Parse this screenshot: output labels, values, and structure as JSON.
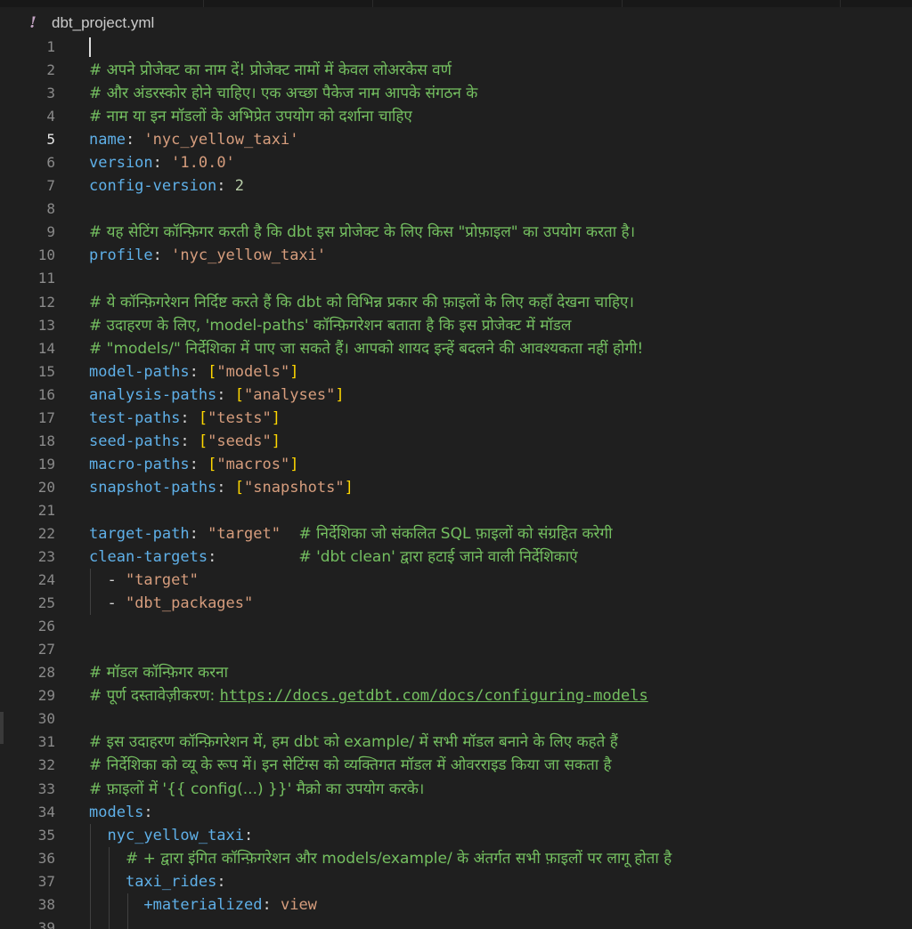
{
  "tab": {
    "icon": "yaml-exclamation-icon",
    "icon_glyph": "!",
    "filename": "dbt_project.yml"
  },
  "editor": {
    "active_line": 5,
    "lines": [
      {
        "n": "1",
        "tokens": []
      },
      {
        "n": "2",
        "tokens": [
          {
            "t": "# अपने प्रोजेक्ट का नाम दें! प्रोजेक्ट नामों में केवल लोअरकेस वर्ण",
            "c": "c"
          }
        ]
      },
      {
        "n": "3",
        "tokens": [
          {
            "t": "# और अंडरस्कोर होने चाहिए। एक अच्छा पैकेज नाम आपके संगठन के",
            "c": "c"
          }
        ]
      },
      {
        "n": "4",
        "tokens": [
          {
            "t": "# नाम या इन मॉडलों के अभिप्रेत उपयोग को दर्शाना चाहिए",
            "c": "c"
          }
        ]
      },
      {
        "n": "5",
        "tokens": [
          {
            "t": "name",
            "c": "k"
          },
          {
            "t": ": ",
            "c": "p"
          },
          {
            "t": "'nyc_yellow_taxi'",
            "c": "s"
          }
        ]
      },
      {
        "n": "6",
        "tokens": [
          {
            "t": "version",
            "c": "k"
          },
          {
            "t": ": ",
            "c": "p"
          },
          {
            "t": "'1.0.0'",
            "c": "s"
          }
        ]
      },
      {
        "n": "7",
        "tokens": [
          {
            "t": "config-version",
            "c": "k"
          },
          {
            "t": ": ",
            "c": "p"
          },
          {
            "t": "2",
            "c": "n"
          }
        ]
      },
      {
        "n": "8",
        "tokens": []
      },
      {
        "n": "9",
        "tokens": [
          {
            "t": "# यह सेटिंग कॉन्फ़िगर करती है कि dbt इस प्रोजेक्ट के लिए किस \"प्रोफ़ाइल\" का उपयोग करता है।",
            "c": "c"
          }
        ]
      },
      {
        "n": "10",
        "tokens": [
          {
            "t": "profile",
            "c": "k"
          },
          {
            "t": ": ",
            "c": "p"
          },
          {
            "t": "'nyc_yellow_taxi'",
            "c": "s"
          }
        ]
      },
      {
        "n": "11",
        "tokens": []
      },
      {
        "n": "12",
        "tokens": [
          {
            "t": "# ये कॉन्फ़िगरेशन निर्दिष्ट करते हैं कि dbt को विभिन्न प्रकार की फ़ाइलों के लिए कहाँ देखना चाहिए।",
            "c": "c"
          }
        ]
      },
      {
        "n": "13",
        "tokens": [
          {
            "t": "# उदाहरण के लिए, 'model-paths' कॉन्फ़िगरेशन बताता है कि इस प्रोजेक्ट में मॉडल",
            "c": "c"
          }
        ]
      },
      {
        "n": "14",
        "tokens": [
          {
            "t": "# \"models/\" निर्देशिका में पाए जा सकते हैं। आपको शायद इन्हें बदलने की आवश्यकता नहीं होगी!",
            "c": "c"
          }
        ]
      },
      {
        "n": "15",
        "tokens": [
          {
            "t": "model-paths",
            "c": "k"
          },
          {
            "t": ": ",
            "c": "p"
          },
          {
            "t": "[",
            "c": "b"
          },
          {
            "t": "\"models\"",
            "c": "s"
          },
          {
            "t": "]",
            "c": "b"
          }
        ]
      },
      {
        "n": "16",
        "tokens": [
          {
            "t": "analysis-paths",
            "c": "k"
          },
          {
            "t": ": ",
            "c": "p"
          },
          {
            "t": "[",
            "c": "b"
          },
          {
            "t": "\"analyses\"",
            "c": "s"
          },
          {
            "t": "]",
            "c": "b"
          }
        ]
      },
      {
        "n": "17",
        "tokens": [
          {
            "t": "test-paths",
            "c": "k"
          },
          {
            "t": ": ",
            "c": "p"
          },
          {
            "t": "[",
            "c": "b"
          },
          {
            "t": "\"tests\"",
            "c": "s"
          },
          {
            "t": "]",
            "c": "b"
          }
        ]
      },
      {
        "n": "18",
        "tokens": [
          {
            "t": "seed-paths",
            "c": "k"
          },
          {
            "t": ": ",
            "c": "p"
          },
          {
            "t": "[",
            "c": "b"
          },
          {
            "t": "\"seeds\"",
            "c": "s"
          },
          {
            "t": "]",
            "c": "b"
          }
        ]
      },
      {
        "n": "19",
        "tokens": [
          {
            "t": "macro-paths",
            "c": "k"
          },
          {
            "t": ": ",
            "c": "p"
          },
          {
            "t": "[",
            "c": "b"
          },
          {
            "t": "\"macros\"",
            "c": "s"
          },
          {
            "t": "]",
            "c": "b"
          }
        ]
      },
      {
        "n": "20",
        "tokens": [
          {
            "t": "snapshot-paths",
            "c": "k"
          },
          {
            "t": ": ",
            "c": "p"
          },
          {
            "t": "[",
            "c": "b"
          },
          {
            "t": "\"snapshots\"",
            "c": "s"
          },
          {
            "t": "]",
            "c": "b"
          }
        ]
      },
      {
        "n": "21",
        "tokens": []
      },
      {
        "n": "22",
        "tokens": [
          {
            "t": "target-path",
            "c": "k"
          },
          {
            "t": ": ",
            "c": "p"
          },
          {
            "t": "\"target\"",
            "c": "s"
          },
          {
            "t": "  ",
            "c": "p"
          },
          {
            "t": "# निर्देशिका जो संकलित SQL फ़ाइलों को संग्रहित करेगी",
            "c": "c"
          }
        ]
      },
      {
        "n": "23",
        "tokens": [
          {
            "t": "clean-targets",
            "c": "k"
          },
          {
            "t": ":         ",
            "c": "p"
          },
          {
            "t": "# 'dbt clean' द्वारा हटाई जाने वाली निर्देशिकाएं",
            "c": "c"
          }
        ]
      },
      {
        "n": "24",
        "tokens": [
          {
            "t": "  - ",
            "c": "p"
          },
          {
            "t": "\"target\"",
            "c": "s"
          }
        ]
      },
      {
        "n": "25",
        "tokens": [
          {
            "t": "  - ",
            "c": "p"
          },
          {
            "t": "\"dbt_packages\"",
            "c": "s"
          }
        ]
      },
      {
        "n": "26",
        "tokens": []
      },
      {
        "n": "27",
        "tokens": []
      },
      {
        "n": "28",
        "tokens": [
          {
            "t": "# मॉडल कॉन्फ़िगर करना",
            "c": "c"
          }
        ]
      },
      {
        "n": "29",
        "tokens": [
          {
            "t": "# पूर्ण दस्तावेज़ीकरण: ",
            "c": "c"
          },
          {
            "t": "https://docs.getdbt.com/docs/configuring-models",
            "c": "link"
          }
        ]
      },
      {
        "n": "30",
        "tokens": []
      },
      {
        "n": "31",
        "tokens": [
          {
            "t": "# इस उदाहरण कॉन्फ़िगरेशन में, हम dbt को example/ में सभी मॉडल बनाने के लिए कहते हैं",
            "c": "c"
          }
        ]
      },
      {
        "n": "32",
        "tokens": [
          {
            "t": "# निर्देशिका को व्यू के रूप में। इन सेटिंग्स को व्यक्तिगत मॉडल में ओवरराइड किया जा सकता है",
            "c": "c"
          }
        ]
      },
      {
        "n": "33",
        "tokens": [
          {
            "t": "# फ़ाइलों में '{{ config(...) }}' मैक्रो का उपयोग करके।",
            "c": "c"
          }
        ]
      },
      {
        "n": "34",
        "tokens": [
          {
            "t": "models",
            "c": "k"
          },
          {
            "t": ":",
            "c": "p"
          }
        ]
      },
      {
        "n": "35",
        "tokens": [
          {
            "t": "  ",
            "c": "p"
          },
          {
            "t": "nyc_yellow_taxi",
            "c": "k"
          },
          {
            "t": ":",
            "c": "p"
          }
        ]
      },
      {
        "n": "36",
        "tokens": [
          {
            "t": "    ",
            "c": "p"
          },
          {
            "t": "# + द्वारा इंगित कॉन्फ़िगरेशन और models/example/ के अंतर्गत सभी फ़ाइलों पर लागू होता है",
            "c": "c"
          }
        ]
      },
      {
        "n": "37",
        "tokens": [
          {
            "t": "    ",
            "c": "p"
          },
          {
            "t": "taxi_rides",
            "c": "k"
          },
          {
            "t": ":",
            "c": "p"
          }
        ]
      },
      {
        "n": "38",
        "tokens": [
          {
            "t": "      ",
            "c": "p"
          },
          {
            "t": "+materialized",
            "c": "k"
          },
          {
            "t": ": ",
            "c": "p"
          },
          {
            "t": "view",
            "c": "s"
          }
        ]
      },
      {
        "n": "39",
        "tokens": []
      }
    ]
  }
}
